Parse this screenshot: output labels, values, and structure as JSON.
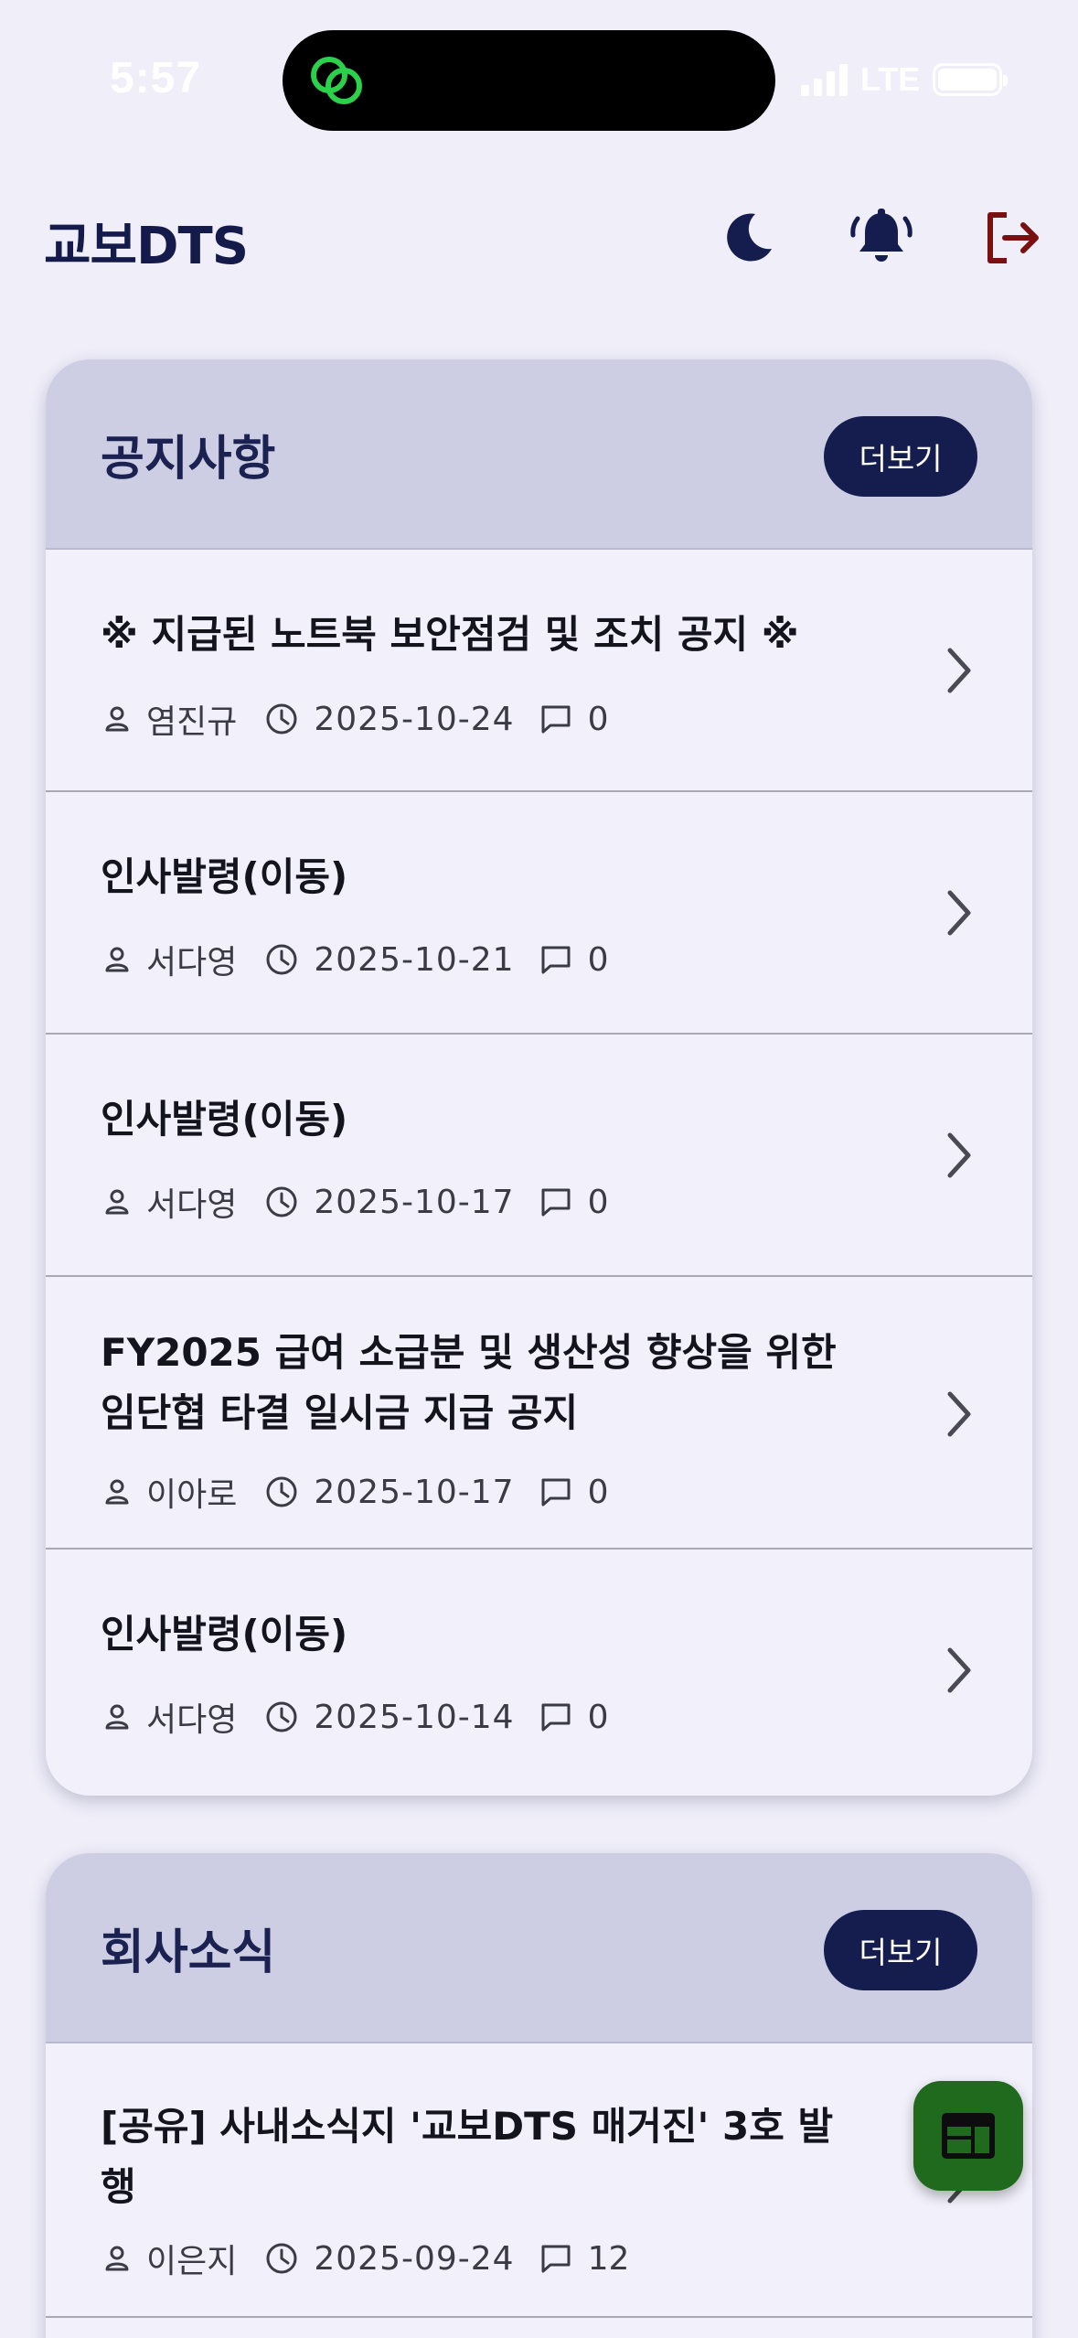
{
  "status_bar": {
    "time": "5:57",
    "network": "LTE",
    "island_icon": "link-rings-icon",
    "island_icon_color": "#2bd14a"
  },
  "header": {
    "title": "교보DTS",
    "actions": [
      {
        "name": "dark-mode-toggle",
        "icon": "moon-icon"
      },
      {
        "name": "notifications",
        "icon": "bell-ringing-icon"
      },
      {
        "name": "logout",
        "icon": "logout-icon",
        "color": "#7a1010"
      }
    ]
  },
  "notices": {
    "title": "공지사항",
    "more_label": "더보기",
    "items": [
      {
        "title": "※ 지급된 노트북 보안점검 및 조치 공지 ※",
        "author": "염진규",
        "date": "2025-10-24",
        "comments": "0"
      },
      {
        "title": "인사발령(이동)",
        "author": "서다영",
        "date": "2025-10-21",
        "comments": "0"
      },
      {
        "title": "인사발령(이동)",
        "author": "서다영",
        "date": "2025-10-17",
        "comments": "0"
      },
      {
        "title_line1": "FY2025 급여 소급분 및 생산성 향상을 위한",
        "title_line2": "임단협 타결 일시금 지급 공지",
        "author": "이아로",
        "date": "2025-10-17",
        "comments": "0"
      },
      {
        "title": "인사발령(이동)",
        "author": "서다영",
        "date": "2025-10-14",
        "comments": "0"
      }
    ]
  },
  "news": {
    "title": "회사소식",
    "more_label": "더보기",
    "items": [
      {
        "title_line1": "[공유] 사내소식지 '교보DTS 매거진' 3호 발",
        "title_line2": "행",
        "author": "이은지",
        "date": "2025-09-24",
        "comments": "12"
      }
    ]
  },
  "fab": {
    "icon": "web-layout-icon",
    "color": "#1f6a1c"
  },
  "colors": {
    "accent": "#141d4e",
    "card_header": "#cdcde4",
    "background": "#efeef9"
  }
}
